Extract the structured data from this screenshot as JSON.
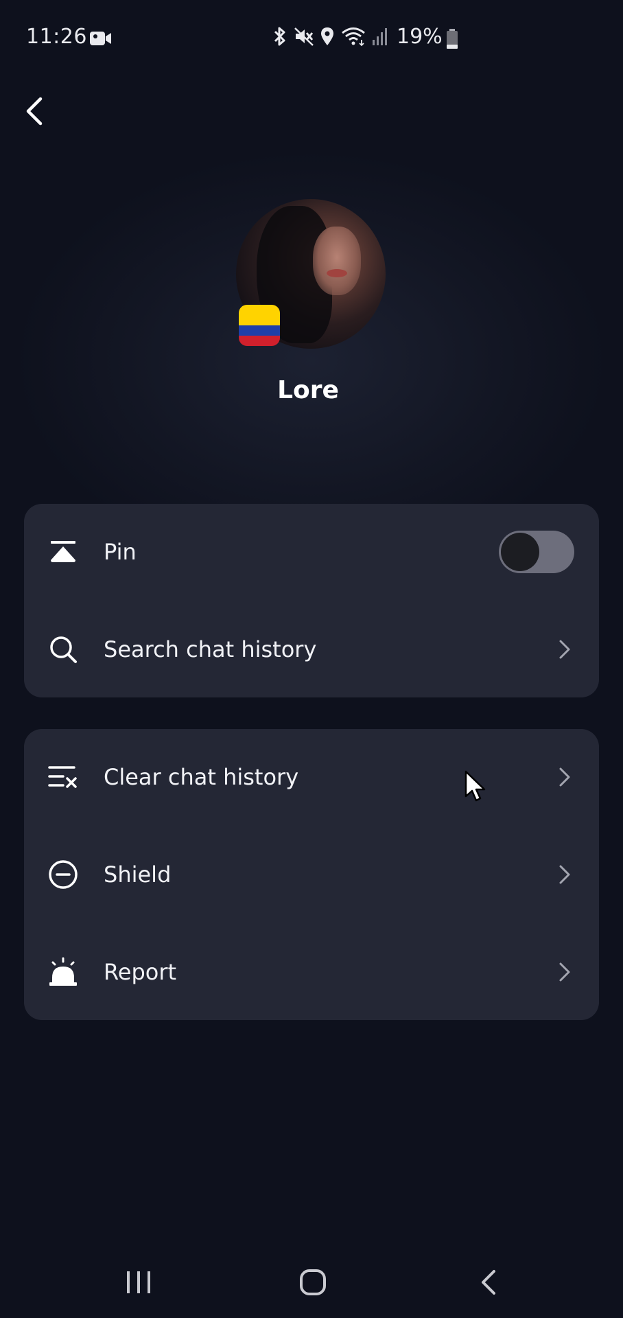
{
  "status_bar": {
    "time": "11:26",
    "battery_percent": "19%",
    "battery_level": 0.19,
    "icons": [
      "video-call-icon",
      "bluetooth-icon",
      "mute-icon",
      "location-icon",
      "wifi-icon",
      "signal-icon",
      "battery-icon"
    ]
  },
  "header": {
    "back_icon": "chevron-left-icon"
  },
  "profile": {
    "name": "Lore",
    "flag": "colombia-flag",
    "colors": {
      "flag_yellow": "#ffd300",
      "flag_blue": "#1f3fa8",
      "flag_red": "#d0202c"
    }
  },
  "settings": {
    "group1": [
      {
        "label": "Pin",
        "icon": "pin-to-top-icon",
        "control": "toggle",
        "toggle_on": false
      },
      {
        "label": "Search chat history",
        "icon": "search-icon",
        "control": "chevron"
      }
    ],
    "group2": [
      {
        "label": "Clear chat history",
        "icon": "clear-list-icon",
        "control": "chevron"
      },
      {
        "label": "Shield",
        "icon": "shield-block-icon",
        "control": "chevron"
      },
      {
        "label": "Report",
        "icon": "alarm-icon",
        "control": "chevron"
      }
    ]
  },
  "nav_bar": {
    "buttons": [
      "recents-icon",
      "home-icon",
      "back-icon"
    ]
  },
  "colors": {
    "background": "#0e111d",
    "card": "#242735",
    "text": "#f1f2f6",
    "toggle_track": "#6d6e7c"
  }
}
